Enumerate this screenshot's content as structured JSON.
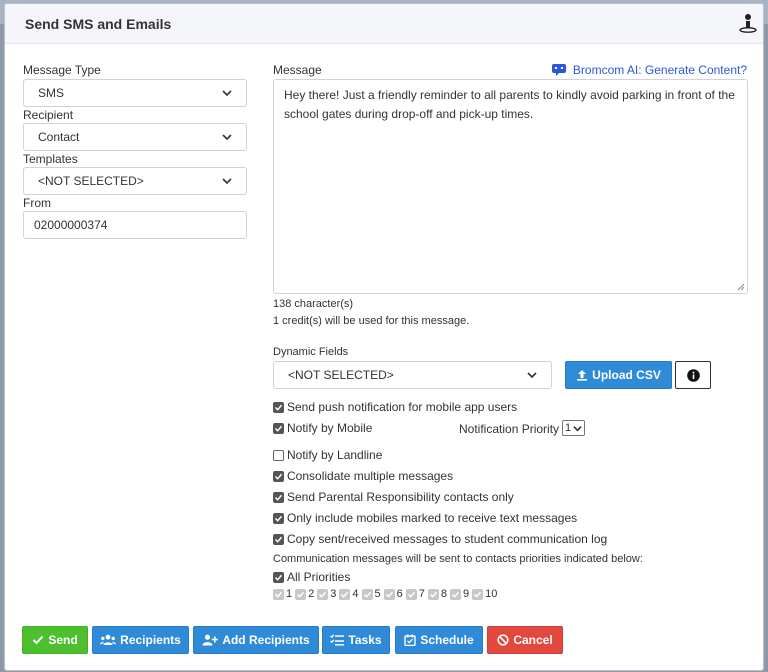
{
  "modal": {
    "title": "Send SMS and Emails"
  },
  "left": {
    "message_type": {
      "label": "Message Type",
      "value": "SMS"
    },
    "recipient": {
      "label": "Recipient",
      "value": "Contact"
    },
    "templates": {
      "label": "Templates",
      "value": "<NOT SELECTED>"
    },
    "from": {
      "label": "From",
      "value": "02000000374"
    }
  },
  "message": {
    "label": "Message",
    "ai_link": "Bromcom AI: Generate Content?",
    "text": "Hey there! Just a friendly reminder to all parents to kindly avoid parking in front of the school gates during drop-off and pick-up times.",
    "char_count": "138 character(s)",
    "credits": "1 credit(s) will be used for this message."
  },
  "dynamic_fields": {
    "label": "Dynamic Fields",
    "value": "<NOT SELECTED>",
    "upload_label": "Upload CSV"
  },
  "options": {
    "push": {
      "label": "Send push notification for mobile app users",
      "checked": true
    },
    "mobile": {
      "label": "Notify by Mobile",
      "checked": true
    },
    "priority_label": "Notification Priority",
    "priority_value": "1",
    "landline": {
      "label": "Notify by Landline",
      "checked": false
    },
    "consolidate": {
      "label": "Consolidate multiple messages",
      "checked": true
    },
    "parental": {
      "label": "Send Parental Responsibility contacts only",
      "checked": true
    },
    "only_mobiles": {
      "label": "Only include mobiles marked to receive text messages",
      "checked": true
    },
    "copy_log": {
      "label": "Copy sent/received messages to student communication log",
      "checked": true
    }
  },
  "priorities": {
    "heading": "Communication messages will be sent to contacts priorities indicated below:",
    "all_label": "All Priorities",
    "items": [
      "1",
      "2",
      "3",
      "4",
      "5",
      "6",
      "7",
      "8",
      "9",
      "10"
    ]
  },
  "footer": {
    "send": "Send",
    "recipients": "Recipients",
    "add_recipients": "Add Recipients",
    "tasks": "Tasks",
    "schedule": "Schedule",
    "cancel": "Cancel"
  },
  "colors": {
    "primary": "#2f8ad8",
    "success": "#4cc12d",
    "danger": "#e3483e",
    "link": "#2d57d8"
  }
}
